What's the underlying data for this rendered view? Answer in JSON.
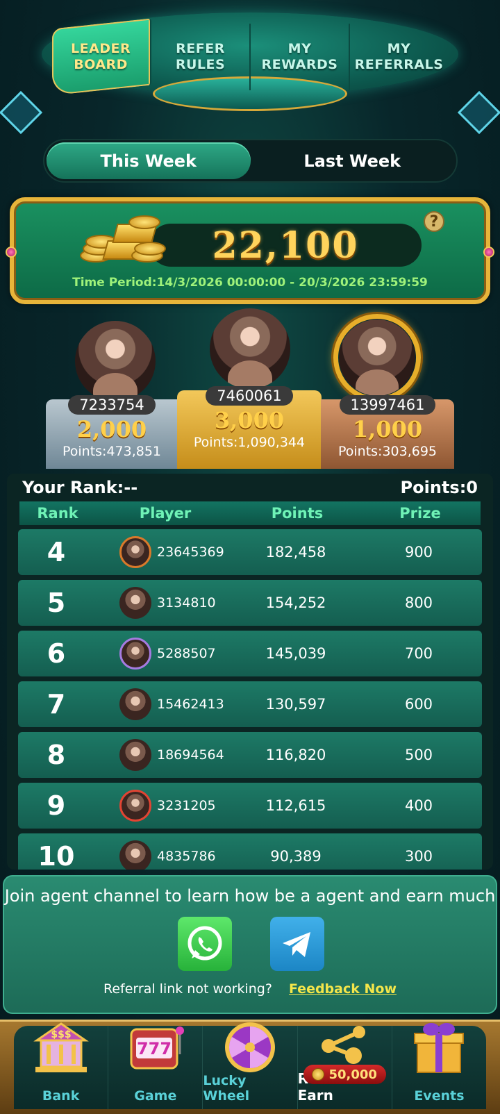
{
  "tabs": [
    {
      "label": "LEADER\nBOARD",
      "active": true
    },
    {
      "label": "REFER\nRULES",
      "active": false
    },
    {
      "label": "MY\nREWARDS",
      "active": false
    },
    {
      "label": "MY\nREFERRALS",
      "active": false
    }
  ],
  "week_toggle": {
    "this_week": "This Week",
    "last_week": "Last Week",
    "selected": "This Week"
  },
  "prize_pool": {
    "amount": "22,100",
    "time_period": "Time Period:14/3/2026 00:00:00 - 20/3/2026 23:59:59",
    "help": "?"
  },
  "podium": {
    "second": {
      "player_id": "7233754",
      "prize": "2,000",
      "points": "Points:473,851"
    },
    "first": {
      "player_id": "7460061",
      "prize": "3,000",
      "points": "Points:1,090,344"
    },
    "third": {
      "player_id": "13997461",
      "prize": "1,000",
      "points": "Points:303,695"
    }
  },
  "your_rank": {
    "rank_label": "Your Rank:--",
    "points_label": "Points:0"
  },
  "table": {
    "headers": {
      "rank": "Rank",
      "player": "Player",
      "points": "Points",
      "prize": "Prize"
    },
    "rows": [
      {
        "rank": "4",
        "player_id": "23645369",
        "points": "182,458",
        "prize": "900"
      },
      {
        "rank": "5",
        "player_id": "3134810",
        "points": "154,252",
        "prize": "800"
      },
      {
        "rank": "6",
        "player_id": "5288507",
        "points": "145,039",
        "prize": "700"
      },
      {
        "rank": "7",
        "player_id": "15462413",
        "points": "130,597",
        "prize": "600"
      },
      {
        "rank": "8",
        "player_id": "18694564",
        "points": "116,820",
        "prize": "500"
      },
      {
        "rank": "9",
        "player_id": "3231205",
        "points": "112,615",
        "prize": "400"
      },
      {
        "rank": "10",
        "player_id": "4835786",
        "points": "90,389",
        "prize": "300"
      }
    ]
  },
  "agent": {
    "text": "Join agent channel to learn how be a agent and earn much",
    "referral_question": "Referral link not working?",
    "feedback_link": "Feedback Now"
  },
  "bottom_nav": {
    "bank": "Bank",
    "game": "Game",
    "lucky_wheel": "Lucky Wheel",
    "refer_earn": "Refer & Earn",
    "refer_badge": "50,000",
    "events": "Events"
  },
  "colors": {
    "accent_green": "#1a9160",
    "gold": "#ffd45c",
    "link_yellow": "#f4e64a"
  }
}
